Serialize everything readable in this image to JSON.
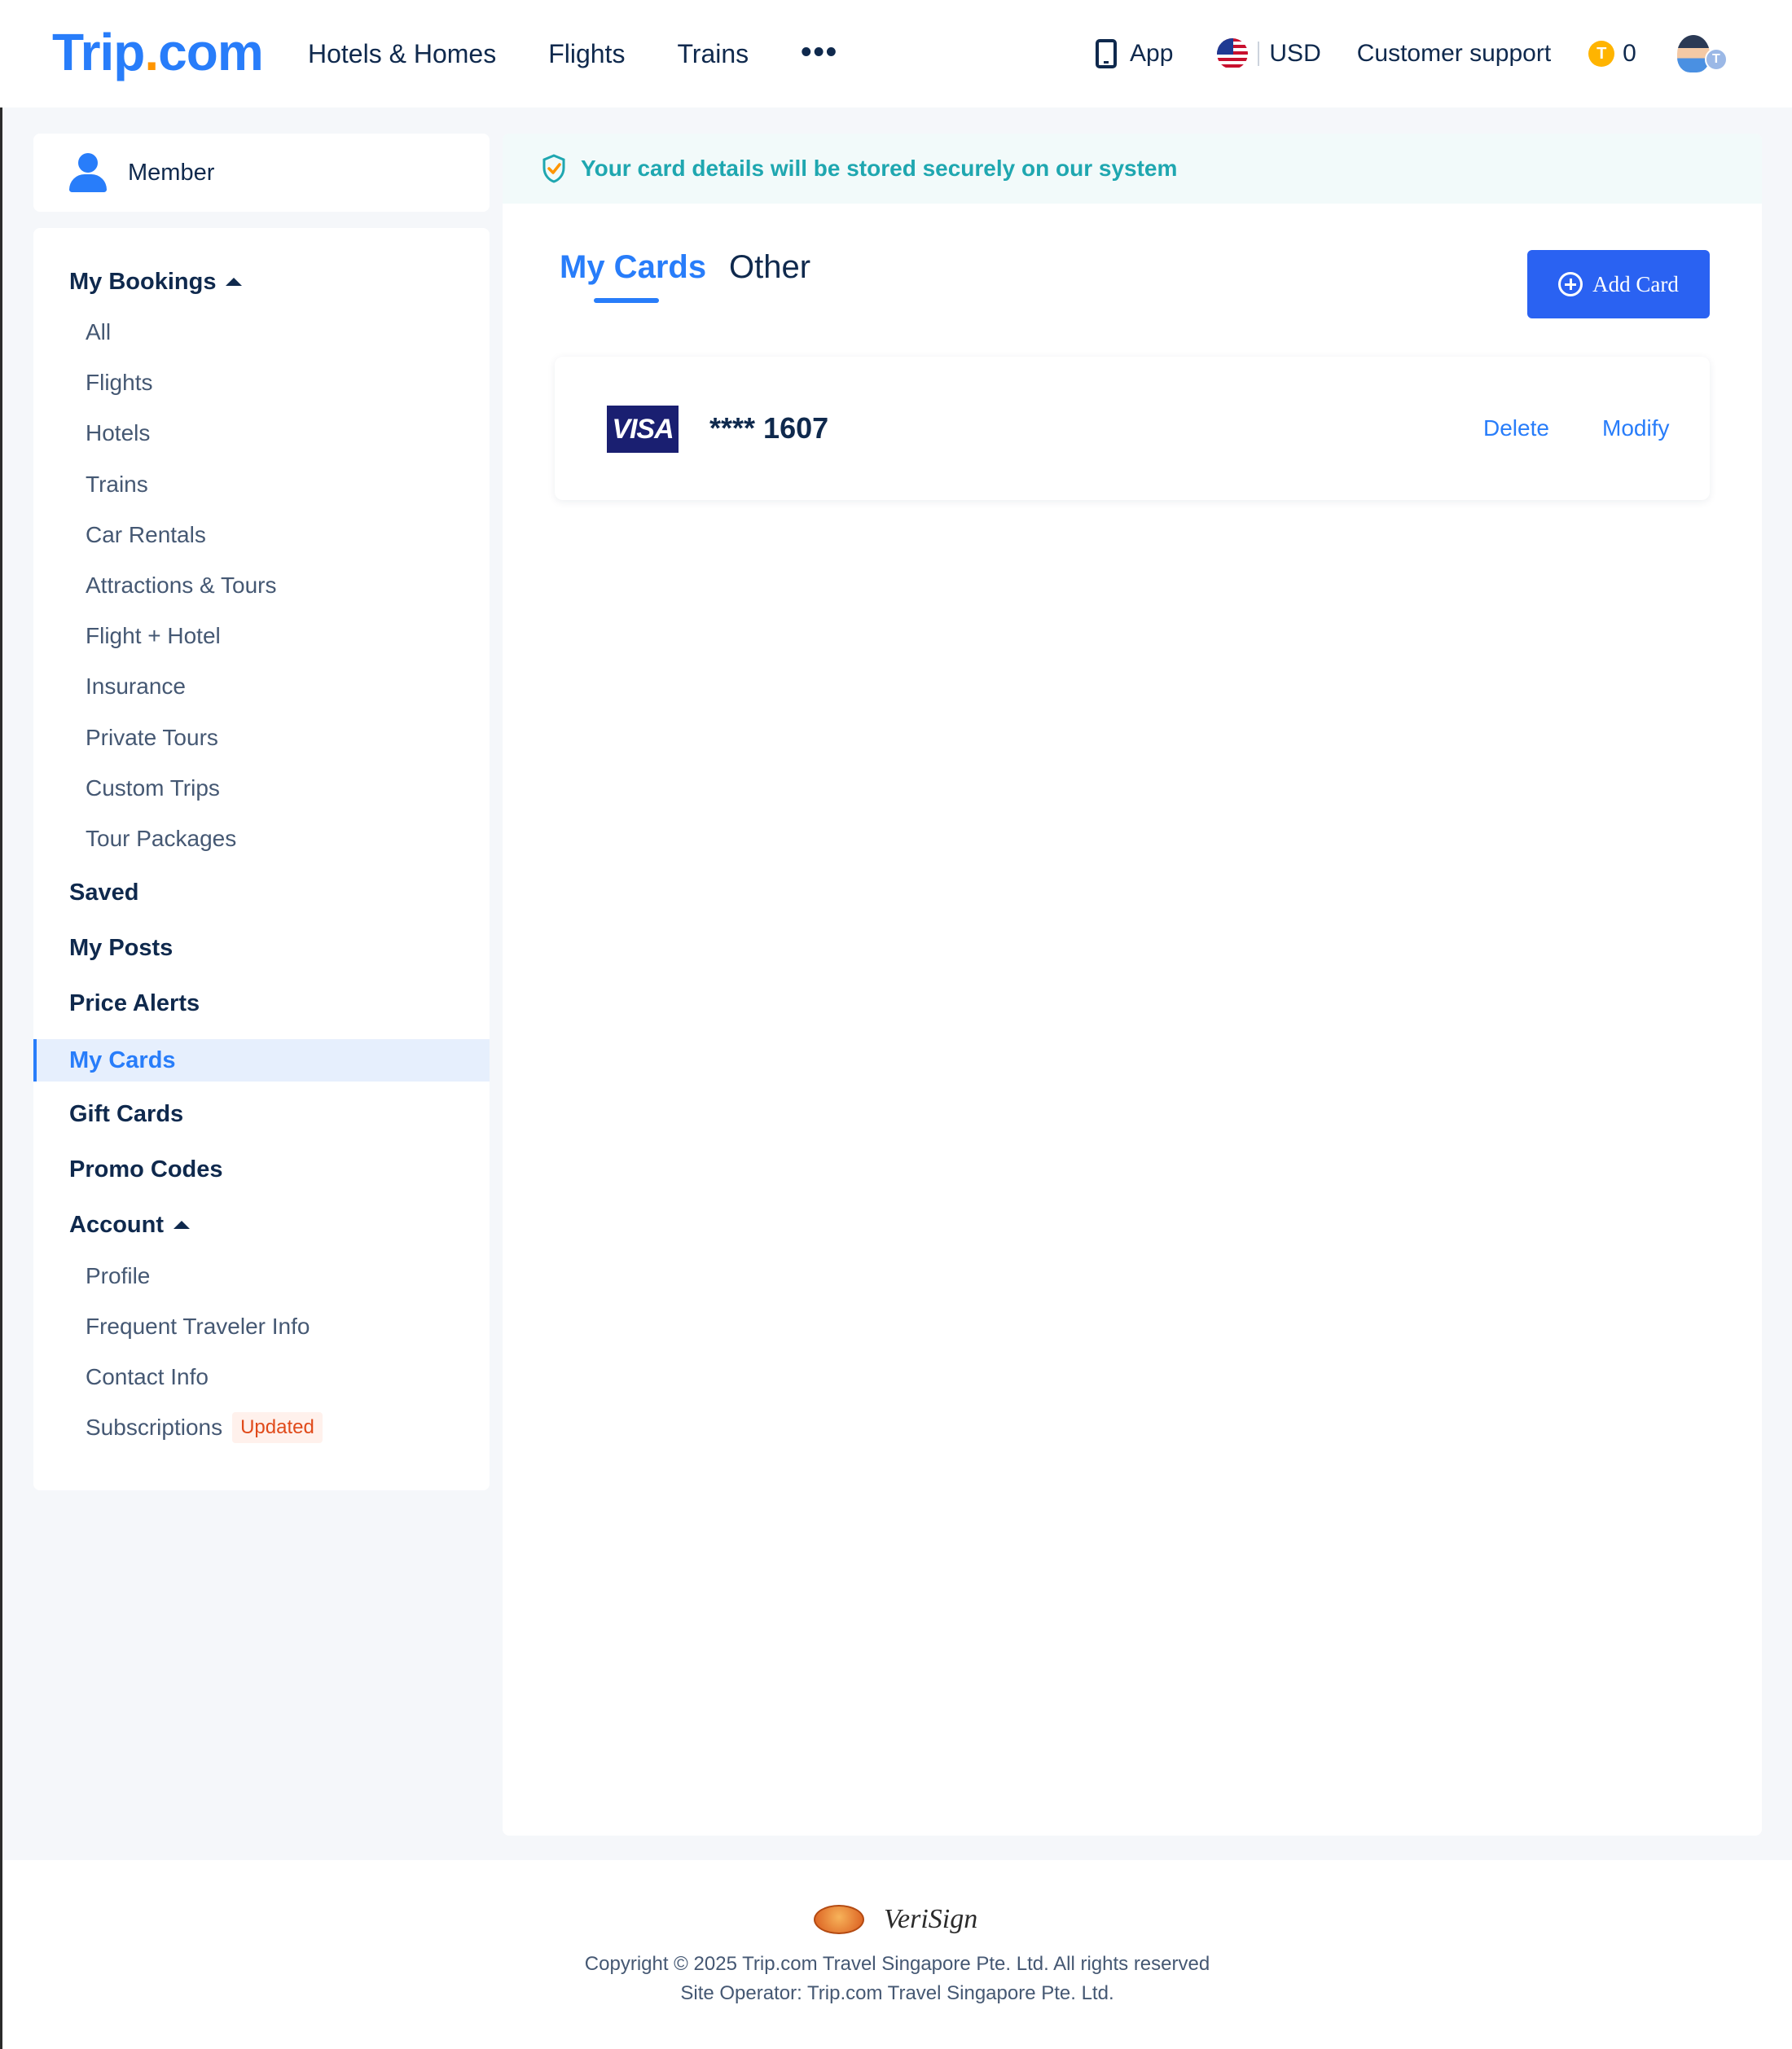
{
  "header": {
    "logo_main": "Trip",
    "logo_dot": ".",
    "logo_tail": "com",
    "nav": [
      "Hotels & Homes",
      "Flights",
      "Trains"
    ],
    "more": "•••",
    "app": "App",
    "currency": "USD",
    "support": "Customer support",
    "coins": "0",
    "coin_symbol": "T"
  },
  "sidebar": {
    "member": "Member",
    "my_bookings": "My Bookings",
    "bookings": [
      "All",
      "Flights",
      "Hotels",
      "Trains",
      "Car Rentals",
      "Attractions & Tours",
      "Flight + Hotel",
      "Insurance",
      "Private Tours",
      "Custom Trips",
      "Tour Packages"
    ],
    "saved": "Saved",
    "my_posts": "My Posts",
    "price_alerts": "Price Alerts",
    "my_cards": "My Cards",
    "gift_cards": "Gift Cards",
    "promo_codes": "Promo Codes",
    "account": "Account",
    "account_items": [
      "Profile",
      "Frequent Traveler Info",
      "Contact Info",
      "Subscriptions"
    ],
    "updated_badge": "Updated"
  },
  "main": {
    "secure_notice": "Your card details will be stored securely on our system",
    "tabs": [
      "My Cards",
      "Other"
    ],
    "add_card": "Add Card",
    "card": {
      "brand": "VISA",
      "number": "**** 1607",
      "delete": "Delete",
      "modify": "Modify"
    }
  },
  "footer": {
    "verisign": "VeriSign",
    "copyright": "Copyright © 2025 Trip.com Travel Singapore Pte. Ltd. All rights reserved",
    "operator": "Site Operator: Trip.com Travel Singapore Pte. Ltd."
  },
  "colors": {
    "brand_blue": "#287dfa",
    "logo_dot": "#ff9500",
    "button_blue": "#2a62f2",
    "secure_teal": "#1fa7b0",
    "badge_red": "#e04a1a"
  },
  "icons": [
    "phone-icon",
    "us-flag-icon",
    "trip-coin-icon",
    "avatar",
    "user-icon",
    "caret-up-icon",
    "shield-check-icon",
    "plus-circle-icon",
    "visa-logo"
  ]
}
